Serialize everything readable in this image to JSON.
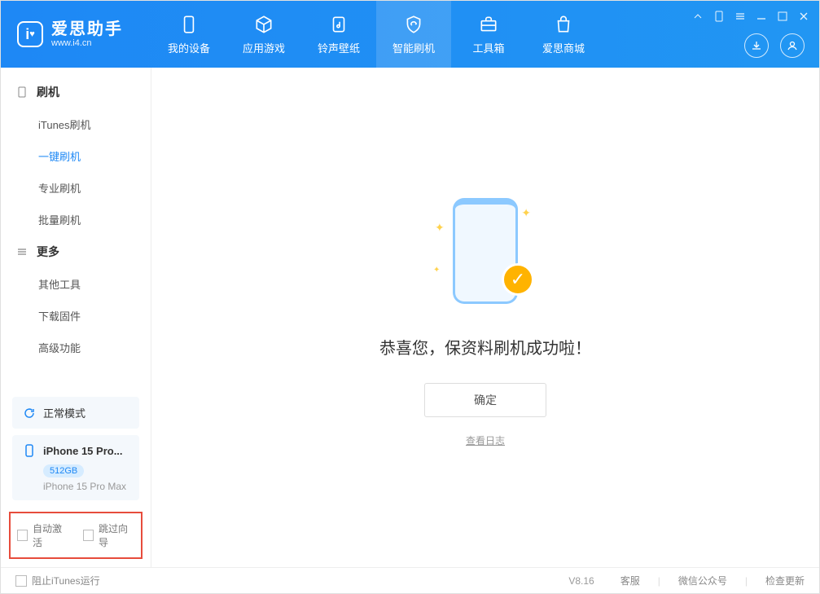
{
  "app": {
    "title": "爱思助手",
    "subtitle": "www.i4.cn"
  },
  "nav": {
    "my_device": "我的设备",
    "apps_games": "应用游戏",
    "ringtones": "铃声壁纸",
    "smart_flash": "智能刷机",
    "toolbox": "工具箱",
    "store": "爱思商城"
  },
  "sidebar": {
    "group_flash": "刷机",
    "itunes_flash": "iTunes刷机",
    "oneclick_flash": "一键刷机",
    "pro_flash": "专业刷机",
    "batch_flash": "批量刷机",
    "group_more": "更多",
    "other_tools": "其他工具",
    "download_fw": "下载固件",
    "advanced": "高级功能"
  },
  "mode": {
    "label": "正常模式"
  },
  "device": {
    "name": "iPhone 15 Pro...",
    "storage": "512GB",
    "model": "iPhone 15 Pro Max"
  },
  "options": {
    "auto_activate": "自动激活",
    "skip_wizard": "跳过向导"
  },
  "main": {
    "success_msg": "恭喜您，保资料刷机成功啦！",
    "ok": "确定",
    "view_log": "查看日志"
  },
  "footer": {
    "block_itunes": "阻止iTunes运行",
    "version": "V8.16",
    "support": "客服",
    "wechat": "微信公众号",
    "check_update": "检查更新"
  }
}
